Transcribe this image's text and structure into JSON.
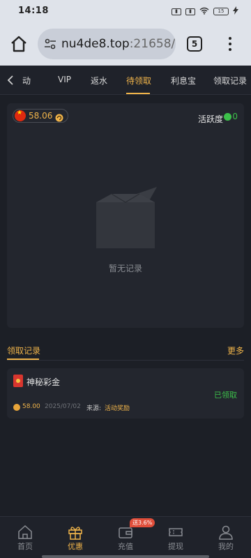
{
  "status_bar": {
    "time": "14:18",
    "battery": "15"
  },
  "browser": {
    "url_host": "nu4de8.top",
    "url_port": ":21658/",
    "tab_count": "5"
  },
  "topnav": {
    "tabs": [
      "动",
      "VIP",
      "返水",
      "待领取",
      "利息宝",
      "领取记录"
    ],
    "active_index": 3
  },
  "card": {
    "balance": "58.06",
    "activity_label": "活跃度",
    "activity_value": "0",
    "empty_text": "暂无记录"
  },
  "records": {
    "title": "领取记录",
    "more": "更多",
    "items": [
      {
        "name": "神秘彩金",
        "status": "已领取",
        "amount": "58.00",
        "date": "2025/07/02",
        "source_label": "来源:",
        "source": "活动奖励"
      }
    ]
  },
  "bottom_nav": {
    "items": [
      {
        "label": "首页",
        "icon": "home-icon"
      },
      {
        "label": "优惠",
        "icon": "gift-icon"
      },
      {
        "label": "充值",
        "icon": "wallet-icon"
      },
      {
        "label": "提现",
        "icon": "ticket-icon"
      },
      {
        "label": "我的",
        "icon": "user-icon"
      }
    ],
    "active_index": 1,
    "promo_badge": "送3.6%"
  },
  "colors": {
    "accent": "#f0b44a",
    "success": "#3cc04a",
    "background": "#1c1f26",
    "card": "#23262e"
  }
}
